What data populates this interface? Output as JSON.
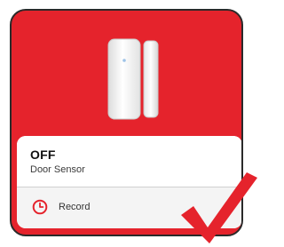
{
  "card": {
    "state": "OFF",
    "device_name": "Door Sensor",
    "record_label": "Record"
  },
  "colors": {
    "hero_background": "#e5232c",
    "accent": "#e5232c",
    "card_border": "#2a2a2a"
  },
  "icons": {
    "product": "door-sensor-image",
    "record": "clock-icon",
    "overlay": "checkmark-icon"
  }
}
